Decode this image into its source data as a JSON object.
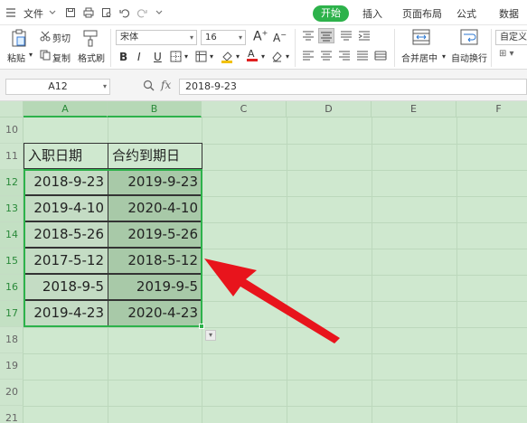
{
  "menubar": {
    "menu_label": "文件",
    "tabs": [
      "开始",
      "插入",
      "页面布局",
      "公式",
      "数据"
    ],
    "active_tab": "开始"
  },
  "ribbon": {
    "paste": "粘贴",
    "cut": "剪切",
    "copy": "复制",
    "format_painter": "格式刷",
    "font_name": "宋体",
    "font_size": "16",
    "merge_center": "合并居中",
    "wrap_text": "自动换行",
    "number_format": "自定义",
    "font_color": "#e02020",
    "fill_color": "#f2c100"
  },
  "formula_bar": {
    "name_box": "A12",
    "fx": "fx",
    "value": "2018-9-23"
  },
  "grid": {
    "columns": [
      "A",
      "B",
      "C",
      "D",
      "E",
      "F"
    ],
    "rows": [
      "10",
      "11",
      "12",
      "13",
      "14",
      "15",
      "16",
      "17",
      "18",
      "19",
      "20",
      "21"
    ],
    "header_row": [
      "入职日期",
      "合约到期日"
    ],
    "data": [
      [
        "2018-9-23",
        "2019-9-23"
      ],
      [
        "2019-4-10",
        "2020-4-10"
      ],
      [
        "2018-5-26",
        "2019-5-26"
      ],
      [
        "2017-5-12",
        "2018-5-12"
      ],
      [
        "2018-9-5",
        "2019-9-5"
      ],
      [
        "2019-4-23",
        "2020-4-23"
      ]
    ]
  },
  "annotation_arrow_color": "#e8141c"
}
